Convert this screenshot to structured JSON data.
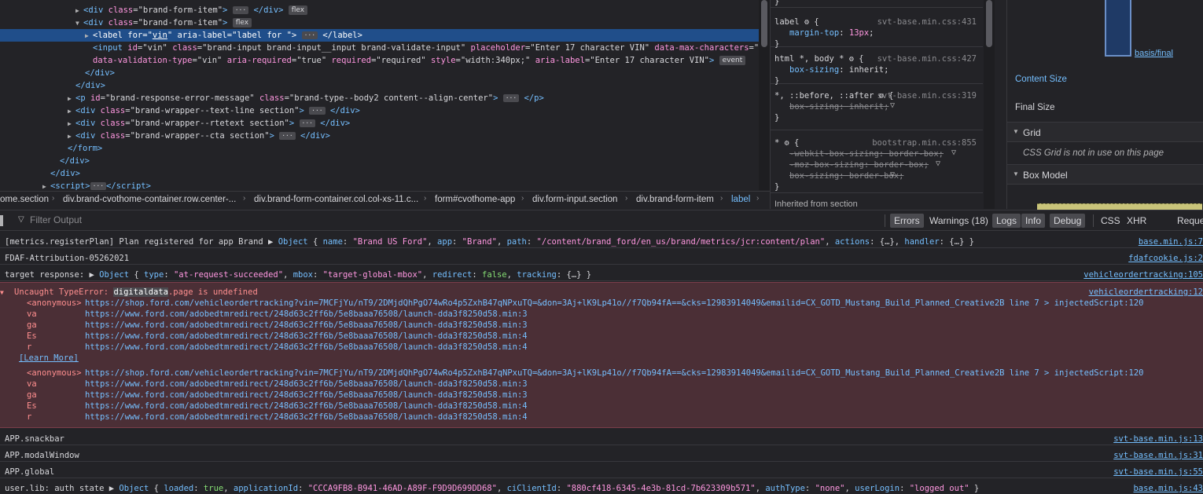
{
  "inspector": {
    "lines": [
      {
        "html": "<span class=\"tri\">▶</span><span class=\"tag\">&lt;div</span> <span class=\"an\">class</span>=<span class=\"av\">\"brand-form-item\"</span><span class=\"tag\">&gt;</span> <span class=\"ell\">···</span> <span class=\"tag\">&lt;/div&gt;</span> <span class=\"badge filled\">flex</span>",
        "indent": 96
      },
      {
        "html": "<span class=\"tri\">▼</span><span class=\"tag\">&lt;div</span> <span class=\"an\">class</span>=<span class=\"av\">\"brand-form-item\"</span><span class=\"tag\">&gt;</span> <span class=\"badge filled\">flex</span>",
        "indent": 96
      },
      {
        "html": "<span class=\"tri\">▶</span><span class=\"tag\">&lt;label</span> <span class=\"an\">for</span>=<span class=\"av\">\"<u>vin</u>\"</span> <span class=\"an\">aria-label</span>=<span class=\"av\">\"label for \"</span><span class=\"tag\">&gt;</span> <span class=\"ell\">···</span> <span class=\"tag\">&lt;/label&gt;</span>",
        "indent": 108,
        "selected": true
      },
      {
        "html": "<span class=\"tag\">&lt;input</span> <span class=\"an\">id</span>=<span class=\"av\">\"vin\"</span> <span class=\"an\">class</span>=<span class=\"av\">\"brand-input brand-input__input brand-validate-input\"</span> <span class=\"an\">placeholder</span>=<span class=\"av\">\"Enter 17 character VIN\"</span> <span class=\"an\">data-max-characters</span>=<span class=\"av\">\"17\"</span>",
        "indent": 118
      },
      {
        "html": "<span class=\"an\">data-validation-type</span>=<span class=\"av\">\"vin\"</span> <span class=\"an\">aria-required</span>=<span class=\"av\">\"true\"</span> <span class=\"an\">required</span>=<span class=\"av\">\"required\"</span> <span class=\"an\">style</span>=<span class=\"av\">\"width:340px;\"</span> <span class=\"an\">aria-label</span>=<span class=\"av\">\"Enter 17 character VIN\"</span><span class=\"tag\">&gt;</span> <span class=\"badge filled\">event</span>",
        "indent": 118
      },
      {
        "html": "<span class=\"tag\">&lt;/div&gt;</span>",
        "indent": 108
      },
      {
        "html": "<span class=\"tag\">&lt;/div&gt;</span>",
        "indent": 96
      },
      {
        "html": "<span class=\"tri\">▶</span><span class=\"tag\">&lt;p</span> <span class=\"an\">id</span>=<span class=\"av\">\"brand-response-error-message\"</span> <span class=\"an\">class</span>=<span class=\"av\">\"brand-type--body2 content--align-center\"</span><span class=\"tag\">&gt;</span> <span class=\"ell\">···</span> <span class=\"tag\">&lt;/p&gt;</span>",
        "indent": 86
      },
      {
        "html": "<span class=\"tri\">▶</span><span class=\"tag\">&lt;div</span> <span class=\"an\">class</span>=<span class=\"av\">\"brand-wrapper--text-line section\"</span><span class=\"tag\">&gt;</span> <span class=\"ell\">···</span> <span class=\"tag\">&lt;/div&gt;</span>",
        "indent": 86
      },
      {
        "html": "<span class=\"tri\">▶</span><span class=\"tag\">&lt;div</span> <span class=\"an\">class</span>=<span class=\"av\">\"brand-wrapper--rtetext section\"</span><span class=\"tag\">&gt;</span> <span class=\"ell\">···</span> <span class=\"tag\">&lt;/div&gt;</span>",
        "indent": 86
      },
      {
        "html": "<span class=\"tri\">▶</span><span class=\"tag\">&lt;div</span> <span class=\"an\">class</span>=<span class=\"av\">\"brand-wrapper--cta section\"</span><span class=\"tag\">&gt;</span> <span class=\"ell\">···</span> <span class=\"tag\">&lt;/div&gt;</span>",
        "indent": 86
      },
      {
        "html": "<span class=\"tag\">&lt;/form&gt;</span>",
        "indent": 86
      },
      {
        "html": "<span class=\"tag\">&lt;/div&gt;</span>",
        "indent": 76
      },
      {
        "html": "<span class=\"tag\">&lt;/div&gt;</span>",
        "indent": 64
      },
      {
        "html": "<span class=\"tri\">▶</span><span class=\"tag\">&lt;script&gt;</span><span class=\"ell\">···</span><span class=\"tag\">&lt;/script&gt;</span>",
        "indent": 54
      }
    ]
  },
  "breadcrumbs": [
    "ome.section",
    "div.brand-cvothome-container.row.center-...",
    "div.brand-form-container.col.col-xs-11.c...",
    "form#cvothome-app",
    "div.form-input.section",
    "div.brand-form-item",
    "label"
  ],
  "rules": [
    {
      "selector": "}",
      "source": "",
      "props": []
    },
    {
      "selector": "label",
      "source": "svt-base.min.css:431",
      "props": [
        {
          "name": "margin-top",
          "value": "13px",
          "struck": false
        }
      ]
    },
    {
      "selector": "html *, body *",
      "source": "svt-base.min.css:427",
      "props": [
        {
          "name": "box-sizing",
          "value": "inherit",
          "struck": false
        }
      ]
    },
    {
      "selector": "*, ::before, ::after",
      "source": "svt-base.min.css:319",
      "props": [
        {
          "name": "box-sizing",
          "value": "inherit",
          "struck": true
        }
      ]
    },
    {
      "selector": "*",
      "source": "bootstrap.min.css:855",
      "props": [
        {
          "name": "-webkit-box-sizing",
          "value": "border-box",
          "struck": true
        },
        {
          "name": "-moz-box-sizing",
          "value": "border-box",
          "struck": true
        },
        {
          "name": "box-sizing",
          "value": "border-box",
          "struck": true
        }
      ]
    }
  ],
  "rules_inherited": "Inherited from section",
  "layout": {
    "basis_label": "basis/final",
    "content_size": "Content Size",
    "final_size": "Final Size",
    "grid_header": "Grid",
    "grid_note": "CSS Grid is not in use on this page",
    "box_model_header": "Box Model"
  },
  "console_toolbar": {
    "filter_placeholder": "Filter Output",
    "buttons": [
      {
        "label": "Errors",
        "on": true
      },
      {
        "label": "Warnings (18)",
        "on": false
      },
      {
        "label": "Logs",
        "on": true
      },
      {
        "label": "Info",
        "on": true
      },
      {
        "label": "Debug",
        "on": true
      },
      {
        "label": "CSS",
        "on": false
      },
      {
        "label": "XHR",
        "on": false
      },
      {
        "label": "Requests",
        "on": false
      }
    ]
  },
  "console": {
    "m1": {
      "html": "[metrics.registerPlan] Plan registered for app Brand <span class=\"plain\">▶</span> <span class=\"obj\">Object</span> { <span class=\"key\">name</span>: <span class=\"str\">\"Brand US Ford\"</span>, <span class=\"key\">app</span>: <span class=\"str\">\"Brand\"</span>, <span class=\"key\">path</span>: <span class=\"str\">\"/content/brand_ford/en_us/brand/metrics/jcr:content/plan\"</span>, <span class=\"key\">actions</span>: {…}, <span class=\"key\">handler</span>: {…} }",
      "loc": "base.min.js:7"
    },
    "m2": {
      "text": "FDAF-Attribution-05262021",
      "loc": "fdafcookie.js:2"
    },
    "m3": {
      "html": "target response: <span class=\"plain\">▶</span> <span class=\"obj\">Object</span> { <span class=\"key\">type</span>: <span class=\"str\">\"at-request-succeeded\"</span>, <span class=\"key\">mbox</span>: <span class=\"str\">\"target-global-mbox\"</span>, <span class=\"key\">redirect</span>: <span class=\"kw\">false</span>, <span class=\"key\">tracking</span>: {…} }",
      "loc": "vehicleordertracking:105"
    },
    "err": {
      "html": "Uncaught TypeError: <span class=\"hl\">digitaldata</span>.page is undefined",
      "loc": "vehicleordertracking:12",
      "trace1": [
        {
          "fn": "<anonymous>",
          "url": "https://shop.ford.com/vehicleordertracking?vin=7MCFjYu/nT9/2DMjdQhPgO74wRo4p5ZxhB47qNPxuTQ=&don=3Aj+lK9Lp41o//f7Qb94fA==&cks=12983914049&emailid=CX_GOTD_Mustang_Build_Planned_Creative2B line 7 > injectedScript:120"
        },
        {
          "fn": "va",
          "url": "https://www.ford.com/adobedtmredirect/248d63c2ff6b/5e8baaa76508/launch-dda3f8250d58.min:3"
        },
        {
          "fn": "ga",
          "url": "https://www.ford.com/adobedtmredirect/248d63c2ff6b/5e8baaa76508/launch-dda3f8250d58.min:3"
        },
        {
          "fn": "Es",
          "url": "https://www.ford.com/adobedtmredirect/248d63c2ff6b/5e8baaa76508/launch-dda3f8250d58.min:4"
        },
        {
          "fn": "r",
          "url": "https://www.ford.com/adobedtmredirect/248d63c2ff6b/5e8baaa76508/launch-dda3f8250d58.min:4"
        }
      ],
      "learn_more": "[Learn More]",
      "trace2": [
        {
          "fn": "<anonymous>",
          "url": "https://shop.ford.com/vehicleordertracking?vin=7MCFjYu/nT9/2DMjdQhPgO74wRo4p5ZxhB47qNPxuTQ=&don=3Aj+lK9Lp41o//f7Qb94fA==&cks=12983914049&emailid=CX_GOTD_Mustang_Build_Planned_Creative2B line 7 > injectedScript:120"
        },
        {
          "fn": "va",
          "url": "https://www.ford.com/adobedtmredirect/248d63c2ff6b/5e8baaa76508/launch-dda3f8250d58.min:3"
        },
        {
          "fn": "ga",
          "url": "https://www.ford.com/adobedtmredirect/248d63c2ff6b/5e8baaa76508/launch-dda3f8250d58.min:3"
        },
        {
          "fn": "Es",
          "url": "https://www.ford.com/adobedtmredirect/248d63c2ff6b/5e8baaa76508/launch-dda3f8250d58.min:4"
        },
        {
          "fn": "r",
          "url": "https://www.ford.com/adobedtmredirect/248d63c2ff6b/5e8baaa76508/launch-dda3f8250d58.min:4"
        }
      ]
    },
    "m5": {
      "text": "APP.snackbar",
      "loc": "svt-base.min.js:13"
    },
    "m6": {
      "text": "APP.modalWindow",
      "loc": "svt-base.min.js:31"
    },
    "m7": {
      "text": "APP.global",
      "loc": "svt-base.min.js:55"
    },
    "m8": {
      "html": "user.lib: auth state <span class=\"plain\">▶</span> <span class=\"obj\">Object</span> { <span class=\"key\">loaded</span>: <span class=\"kw\">true</span>, <span class=\"key\">applicationId</span>: <span class=\"str\">\"CCCA9FB8-B941-46AD-A89F-F9D9D699DD68\"</span>, <span class=\"key\">ciClientId</span>: <span class=\"str\">\"880cf418-6345-4e3b-81cd-7b623309b571\"</span>, <span class=\"key\">authType</span>: <span class=\"str\">\"none\"</span>, <span class=\"key\">userLogin</span>: <span class=\"str\">\"logged out\"</span> }",
      "loc": "base.min.js:43"
    }
  }
}
